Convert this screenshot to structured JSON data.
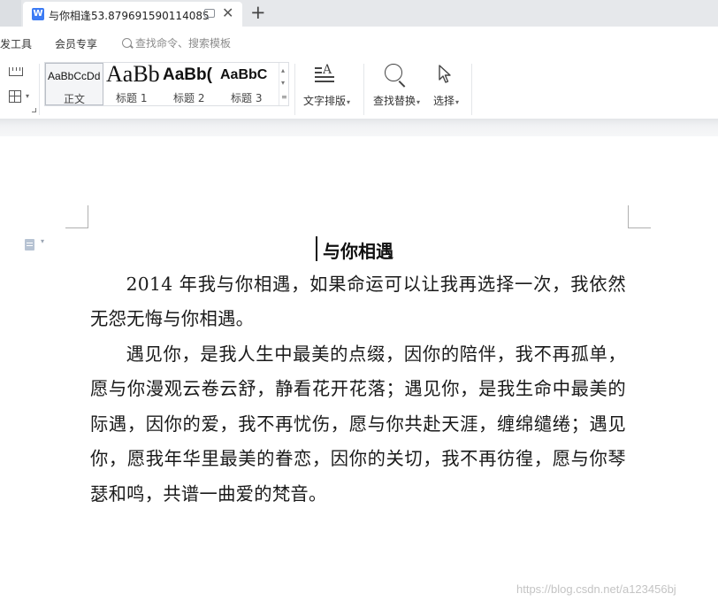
{
  "tab": {
    "title": "与你相逢53.879691590114085",
    "doc_icon": "wps-doc-icon",
    "close_icon": "✕",
    "new_tab_icon": "+"
  },
  "menu": {
    "dev_tools": "发工具",
    "member": "会员专享",
    "search_placeholder": "查找命令、搜索模板"
  },
  "ribbon": {
    "styles": [
      {
        "preview": "AaBbCcDd",
        "name": "正文",
        "selected": true
      },
      {
        "preview": "AaBb",
        "name": "标题 1"
      },
      {
        "preview": "AaBb(",
        "name": "标题 2"
      },
      {
        "preview": "AaBbC",
        "name": "标题 3"
      }
    ],
    "text_layout": "文字排版",
    "find_replace": "查找替换",
    "select": "选择"
  },
  "document": {
    "title": "与你相遇",
    "paragraphs": [
      "2014 年我与你相遇，如果命运可以让我再选择一次，我依然无怨无悔与你相遇。",
      "遇见你，是我人生中最美的点缀，因你的陪伴，我不再孤单，愿与你漫观云卷云舒，静看花开花落；遇见你，是我生命中最美的际遇，因你的爱，我不再忧伤，愿与你共赴天涯，缠绵缱绻；遇见你，愿我年华里最美的眷恋，因你的关切，我不再彷徨，愿与你琴瑟和鸣，共谱一曲爱的梵音。"
    ]
  },
  "watermark": "https://blog.csdn.net/a123456bj",
  "colors": {
    "accent": "#3c7bf4",
    "tabbar_bg": "#e6e8eb"
  }
}
